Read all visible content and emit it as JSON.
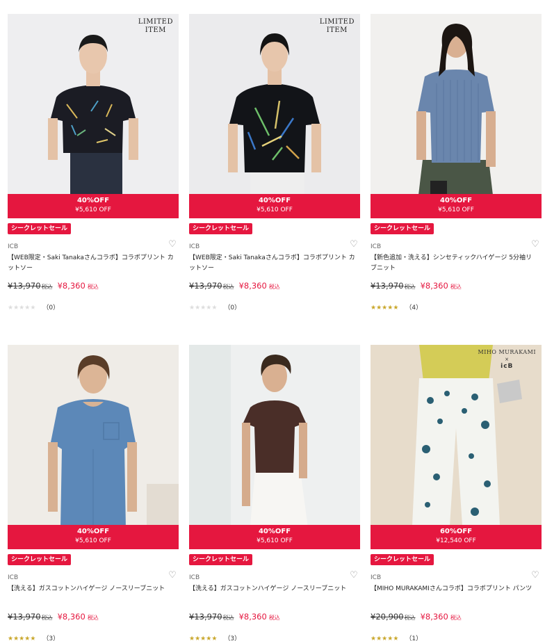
{
  "products": [
    {
      "limited": [
        "LIMITED",
        "ITEM"
      ],
      "discount_pct": "40%OFF",
      "discount_amt": "¥5,610 OFF",
      "badge": "シークレットセール",
      "brand": "ICB",
      "title": "【WEB限定・Saki Tanakaさんコラボ】コラボプリント カットソー",
      "orig_price": "¥13,970",
      "orig_tax": "税込",
      "sale_price": "¥8,360",
      "sale_tax": "税込",
      "rating": 0,
      "review_count": "（0）"
    },
    {
      "limited": [
        "LIMITED",
        "ITEM"
      ],
      "discount_pct": "40%OFF",
      "discount_amt": "¥5,610 OFF",
      "badge": "シークレットセール",
      "brand": "ICB",
      "title": "【WEB限定・Saki Tanakaさんコラボ】コラボプリント カットソー",
      "orig_price": "¥13,970",
      "orig_tax": "税込",
      "sale_price": "¥8,360",
      "sale_tax": "税込",
      "rating": 0,
      "review_count": "（0）"
    },
    {
      "discount_pct": "40%OFF",
      "discount_amt": "¥5,610 OFF",
      "badge": "シークレットセール",
      "brand": "ICB",
      "title": "【新色追加・洗える】シンセティックハイゲージ 5分袖リブニット",
      "orig_price": "¥13,970",
      "orig_tax": "税込",
      "sale_price": "¥8,360",
      "sale_tax": "税込",
      "rating": 4.5,
      "review_count": "（4）"
    },
    {
      "discount_pct": "40%OFF",
      "discount_amt": "¥5,610 OFF",
      "badge": "シークレットセール",
      "brand": "ICB",
      "title": "【洗える】ガスコットンハイゲージ ノースリーブニット",
      "orig_price": "¥13,970",
      "orig_tax": "税込",
      "sale_price": "¥8,360",
      "sale_tax": "税込",
      "rating": 4.5,
      "review_count": "（3）"
    },
    {
      "discount_pct": "40%OFF",
      "discount_amt": "¥5,610 OFF",
      "badge": "シークレットセール",
      "brand": "ICB",
      "title": "【洗える】ガスコットンハイゲージ ノースリーブニット",
      "orig_price": "¥13,970",
      "orig_tax": "税込",
      "sale_price": "¥8,360",
      "sale_tax": "税込",
      "rating": 4.5,
      "review_count": "（3）"
    },
    {
      "collab": {
        "line1": "MIHO MURAKAMI",
        "line2": "×",
        "line3": "icB"
      },
      "discount_pct": "60%OFF",
      "discount_amt": "¥12,540 OFF",
      "badge": "シークレットセール",
      "brand": "ICB",
      "title": "【MIHO MURAKAMIさんコラボ】コラボプリント パンツ",
      "orig_price": "¥20,900",
      "orig_tax": "税込",
      "sale_price": "¥8,360",
      "sale_tax": "税込",
      "rating": 5,
      "review_count": "（1）"
    }
  ],
  "colors": {
    "sale_red": "#e5173f",
    "star_gold": "#c9a72b"
  }
}
